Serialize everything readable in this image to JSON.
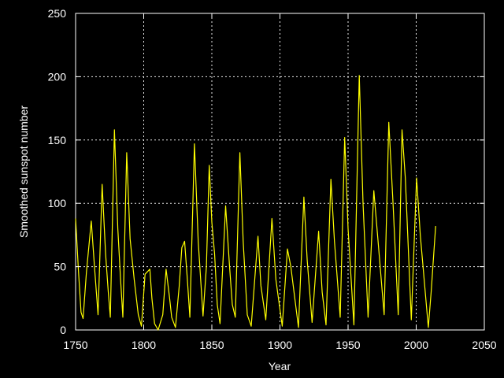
{
  "chart_data": {
    "type": "line",
    "title": "",
    "xlabel": "Year",
    "ylabel": "Smoothed sunspot number",
    "xlim": [
      1750,
      2050
    ],
    "ylim": [
      0,
      250
    ],
    "x_ticks": [
      "1750",
      "1800",
      "1850",
      "1900",
      "1950",
      "2000",
      "2050"
    ],
    "y_ticks": [
      "0",
      "50",
      "100",
      "150",
      "200",
      "250"
    ],
    "grid": true,
    "background": "#000000",
    "foreground": "#ffffff",
    "series": [
      {
        "color": "#ffff00",
        "points": [
          [
            1750,
            88
          ],
          [
            1752,
            48
          ],
          [
            1754,
            14
          ],
          [
            1755.5,
            9
          ],
          [
            1758,
            46
          ],
          [
            1761.5,
            86
          ],
          [
            1764,
            48
          ],
          [
            1766.5,
            12
          ],
          [
            1769.5,
            115
          ],
          [
            1772,
            60
          ],
          [
            1774,
            30
          ],
          [
            1775.5,
            10
          ],
          [
            1778.5,
            158
          ],
          [
            1781,
            80
          ],
          [
            1783,
            40
          ],
          [
            1784.7,
            10
          ],
          [
            1787.5,
            140
          ],
          [
            1790,
            72
          ],
          [
            1793,
            40
          ],
          [
            1796,
            12
          ],
          [
            1798.3,
            3
          ],
          [
            1801,
            44
          ],
          [
            1804.5,
            48
          ],
          [
            1806,
            25
          ],
          [
            1808,
            5
          ],
          [
            1810.6,
            0
          ],
          [
            1814,
            12
          ],
          [
            1816.4,
            48
          ],
          [
            1819,
            25
          ],
          [
            1820.5,
            10
          ],
          [
            1823.3,
            2
          ],
          [
            1826,
            34
          ],
          [
            1828,
            65
          ],
          [
            1830,
            70
          ],
          [
            1832,
            40
          ],
          [
            1833.9,
            10
          ],
          [
            1837.2,
            147
          ],
          [
            1840,
            70
          ],
          [
            1843.5,
            11
          ],
          [
            1846,
            50
          ],
          [
            1848.1,
            130
          ],
          [
            1850,
            85
          ],
          [
            1852,
            60
          ],
          [
            1854,
            20
          ],
          [
            1856,
            5
          ],
          [
            1860.1,
            98
          ],
          [
            1863,
            50
          ],
          [
            1865,
            20
          ],
          [
            1867.2,
            10
          ],
          [
            1870.6,
            140
          ],
          [
            1873,
            70
          ],
          [
            1876,
            12
          ],
          [
            1878.9,
            3
          ],
          [
            1883.9,
            74
          ],
          [
            1886,
            35
          ],
          [
            1889.6,
            8
          ],
          [
            1894.1,
            88
          ],
          [
            1897,
            40
          ],
          [
            1901.7,
            3
          ],
          [
            1905.5,
            64
          ],
          [
            1908,
            50
          ],
          [
            1913.6,
            2
          ],
          [
            1917.6,
            105
          ],
          [
            1920,
            55
          ],
          [
            1923.6,
            6
          ],
          [
            1928.4,
            78
          ],
          [
            1931,
            30
          ],
          [
            1933.8,
            4
          ],
          [
            1937.4,
            119
          ],
          [
            1940,
            70
          ],
          [
            1944.2,
            10
          ],
          [
            1947.5,
            152
          ],
          [
            1950,
            80
          ],
          [
            1954.3,
            4
          ],
          [
            1958.2,
            201
          ],
          [
            1961,
            100
          ],
          [
            1964.7,
            10
          ],
          [
            1968.9,
            110
          ],
          [
            1972,
            70
          ],
          [
            1976.5,
            12
          ],
          [
            1979.9,
            164
          ],
          [
            1983,
            100
          ],
          [
            1986.8,
            12
          ],
          [
            1989.6,
            158
          ],
          [
            1992,
            120
          ],
          [
            1996.4,
            8
          ],
          [
            2000.3,
            120
          ],
          [
            2003,
            75
          ],
          [
            2008.9,
            2
          ],
          [
            2011,
            30
          ],
          [
            2014.3,
            82
          ]
        ]
      }
    ]
  }
}
